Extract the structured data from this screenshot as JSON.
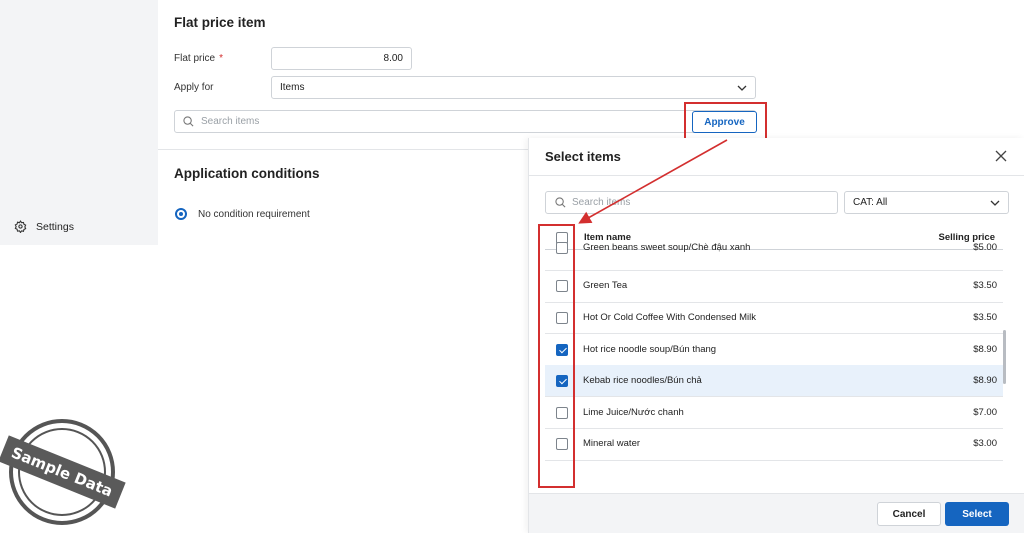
{
  "sidebar": {
    "settings_label": "Settings"
  },
  "flat_price": {
    "title": "Flat price item",
    "price_label": "Flat price",
    "required_mark": "*",
    "price_value": "8.00",
    "apply_label": "Apply for",
    "apply_value": "Items",
    "search_placeholder": "Search items",
    "approve_label": "Approve"
  },
  "conditions": {
    "title": "Application conditions",
    "option_label": "No condition requirement"
  },
  "panel": {
    "title": "Select items",
    "search_placeholder": "Search items",
    "category_value": "CAT: All",
    "columns": {
      "name": "Item name",
      "price": "Selling price"
    },
    "rows": [
      {
        "name": "Green beans sweet soup/Chè đậu xanh",
        "price": "$5.00",
        "checked": false
      },
      {
        "name": "Green Tea",
        "price": "$3.50",
        "checked": false
      },
      {
        "name": "Hot Or Cold Coffee With Condensed Milk",
        "price": "$3.50",
        "checked": false
      },
      {
        "name": "Hot rice noodle soup/Bún thang",
        "price": "$8.90",
        "checked": true
      },
      {
        "name": "Kebab rice noodles/Bún chả",
        "price": "$8.90",
        "checked": true
      },
      {
        "name": "Lime Juice/Nước chanh",
        "price": "$7.00",
        "checked": false
      },
      {
        "name": "Mineral water",
        "price": "$3.00",
        "checked": false
      }
    ],
    "cancel_label": "Cancel",
    "select_label": "Select"
  },
  "watermark": {
    "text": "Sample Data"
  },
  "colors": {
    "accent": "#1565c0",
    "highlight": "#d32f2f",
    "selected_row": "#e8f1fb"
  }
}
